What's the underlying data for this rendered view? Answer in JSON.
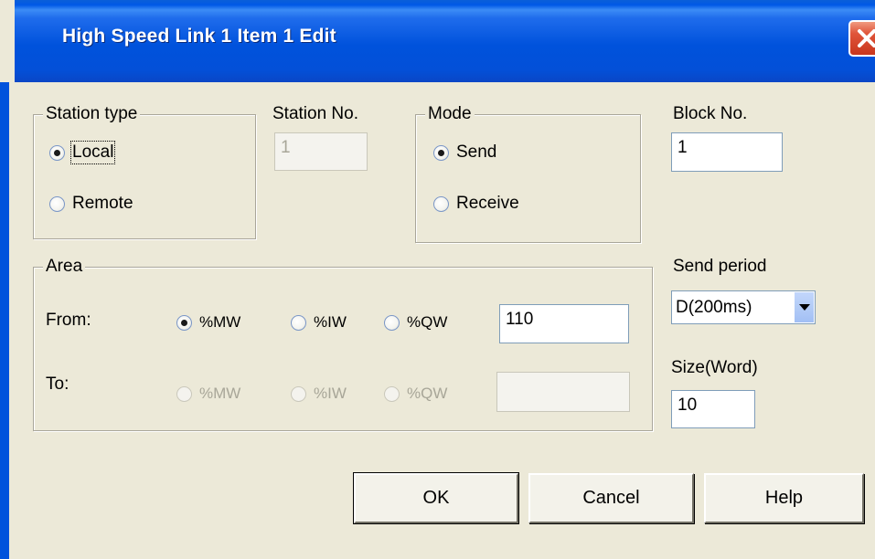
{
  "window": {
    "title": "High Speed Link 1 Item 1    Edit"
  },
  "station_type": {
    "legend": "Station type",
    "options": [
      "Local",
      "Remote"
    ],
    "selected": "Local"
  },
  "station_no": {
    "label": "Station No.",
    "value": "1"
  },
  "mode": {
    "legend": "Mode",
    "options": [
      "Send",
      "Receive"
    ],
    "selected": "Send"
  },
  "block_no": {
    "label": "Block No.",
    "value": "1"
  },
  "area": {
    "legend": "Area",
    "from": {
      "label": "From:",
      "options": [
        "%MW",
        "%IW",
        "%QW"
      ],
      "selected": "%MW",
      "value": "110"
    },
    "to": {
      "label": "To:",
      "options": [
        "%MW",
        "%IW",
        "%QW"
      ],
      "selected": null,
      "value": ""
    }
  },
  "send_period": {
    "label": "Send period",
    "value": "D(200ms)"
  },
  "size": {
    "label": "Size(Word)",
    "value": "10"
  },
  "buttons": {
    "ok": "OK",
    "cancel": "Cancel",
    "help": "Help"
  },
  "icons": {
    "close": "close-icon",
    "dropdown": "chevron-down-icon"
  }
}
